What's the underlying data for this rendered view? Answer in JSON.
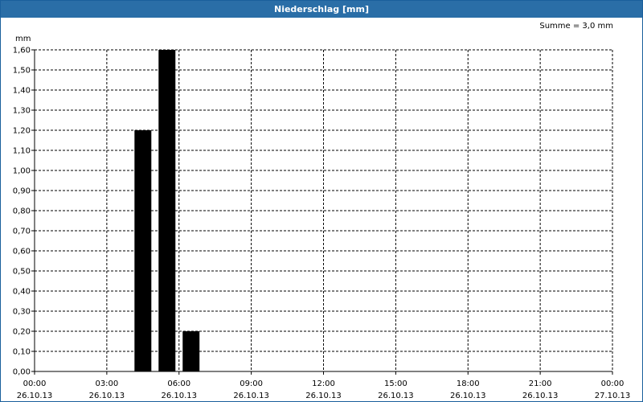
{
  "window": {
    "title": "Niederschlag [mm]"
  },
  "summary": "Summe = 3,0 mm",
  "chart_data": {
    "type": "bar",
    "title": "Niederschlag [mm]",
    "ylabel": "mm",
    "ylim": [
      0,
      1.6
    ],
    "xlim_hours": [
      0,
      24
    ],
    "grid": true,
    "y_ticks": [
      "0,00",
      "0,10",
      "0,20",
      "0,30",
      "0,40",
      "0,50",
      "0,60",
      "0,70",
      "0,80",
      "0,90",
      "1,00",
      "1,10",
      "1,20",
      "1,30",
      "1,40",
      "1,50",
      "1,60"
    ],
    "x_ticks": [
      {
        "time": "00:00",
        "date": "26.10.13"
      },
      {
        "time": "03:00",
        "date": "26.10.13"
      },
      {
        "time": "06:00",
        "date": "26.10.13"
      },
      {
        "time": "09:00",
        "date": "26.10.13"
      },
      {
        "time": "12:00",
        "date": "26.10.13"
      },
      {
        "time": "15:00",
        "date": "26.10.13"
      },
      {
        "time": "18:00",
        "date": "26.10.13"
      },
      {
        "time": "21:00",
        "date": "26.10.13"
      },
      {
        "time": "00:00",
        "date": "27.10.13"
      }
    ],
    "series": [
      {
        "x": [
          "26.10.13 04:30",
          "26.10.13 05:30",
          "26.10.13 06:30"
        ],
        "values": [
          1.2,
          1.6,
          0.2
        ]
      }
    ],
    "bar_color": "#000000"
  }
}
